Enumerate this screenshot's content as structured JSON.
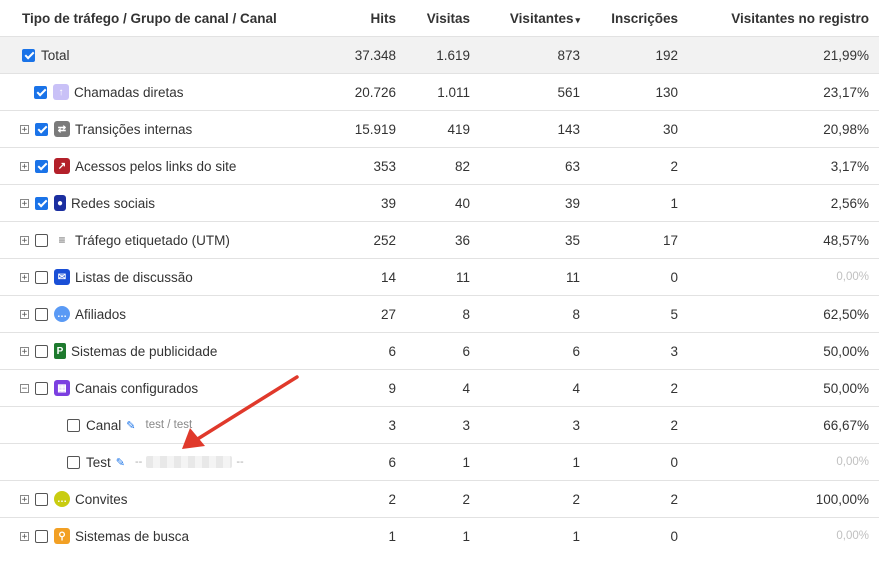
{
  "headers": {
    "channel": "Tipo de tráfego / Grupo de canal / Canal",
    "hits": "Hits",
    "visits": "Visitas",
    "visitors": "Visitantes",
    "signups": "Inscrições",
    "reg_visitors": "Visitantes no registro",
    "sort_indicator": "▾"
  },
  "rows": [
    {
      "label": "Total",
      "hits": "37.348",
      "visits": "1.619",
      "visitors": "873",
      "signups": "192",
      "reg": "21,99%"
    },
    {
      "label": "Chamadas diretas",
      "hits": "20.726",
      "visits": "1.011",
      "visitors": "561",
      "signups": "130",
      "reg": "23,17%",
      "icon": "arrow-up-icon"
    },
    {
      "label": "Transições internas",
      "hits": "15.919",
      "visits": "419",
      "visitors": "143",
      "signups": "30",
      "reg": "20,98%",
      "icon": "swap-arrows-icon"
    },
    {
      "label": "Acessos pelos links do site",
      "hits": "353",
      "visits": "82",
      "visitors": "63",
      "signups": "2",
      "reg": "3,17%",
      "icon": "external-link-icon"
    },
    {
      "label": "Redes sociais",
      "hits": "39",
      "visits": "40",
      "visitors": "39",
      "signups": "1",
      "reg": "2,56%",
      "icon": "person-icon"
    },
    {
      "label": "Tráfego etiquetado (UTM)",
      "hits": "252",
      "visits": "36",
      "visitors": "35",
      "signups": "17",
      "reg": "48,57%",
      "icon": "list-icon"
    },
    {
      "label": "Listas de discussão",
      "hits": "14",
      "visits": "11",
      "visitors": "11",
      "signups": "0",
      "reg": "0,00%",
      "icon": "envelope-icon"
    },
    {
      "label": "Afiliados",
      "hits": "27",
      "visits": "8",
      "visitors": "8",
      "signups": "5",
      "reg": "62,50%",
      "icon": "chat-bubble-icon"
    },
    {
      "label": "Sistemas de publicidade",
      "hits": "6",
      "visits": "6",
      "visitors": "6",
      "signups": "3",
      "reg": "50,00%",
      "icon": "p-badge-icon"
    },
    {
      "label": "Canais configurados",
      "hits": "9",
      "visits": "4",
      "visitors": "4",
      "signups": "2",
      "reg": "50,00%",
      "icon": "grid-icon"
    },
    {
      "label": "Canal",
      "sub": "test / test",
      "hits": "3",
      "visits": "3",
      "visitors": "3",
      "signups": "2",
      "reg": "66,67%",
      "icon": "pencil-edit-icon"
    },
    {
      "label": "Test",
      "sub_prefix": "--",
      "sub_suffix": "--",
      "hits": "6",
      "visits": "1",
      "visitors": "1",
      "signups": "0",
      "reg": "0,00%",
      "icon": "pencil-edit-icon"
    },
    {
      "label": "Convites",
      "hits": "2",
      "visits": "2",
      "visitors": "2",
      "signups": "2",
      "reg": "100,00%",
      "icon": "chat-bubble-icon"
    },
    {
      "label": "Sistemas de busca",
      "hits": "1",
      "visits": "1",
      "visitors": "1",
      "signups": "0",
      "reg": "0,00%",
      "icon": "magnifier-icon"
    }
  ],
  "glyphs": {
    "expand": "+",
    "collapse": "−",
    "edit": "✎"
  },
  "colors": {
    "checkbox_blue": "#1a73e8",
    "direct_icon": "#c9c1f7",
    "internal_icon": "#7a7a7a",
    "links_icon": "#b3202a",
    "social_icon": "#1b2fa0",
    "mail_icon": "#1a4fd6",
    "affiliate_icon": "#5a9af5",
    "ads_icon": "#1e7a2e",
    "configured_icon": "#7b3fe0",
    "invites_icon": "#c9cc10",
    "search_icon": "#f2a024",
    "annotation_arrow": "#e0392b"
  }
}
